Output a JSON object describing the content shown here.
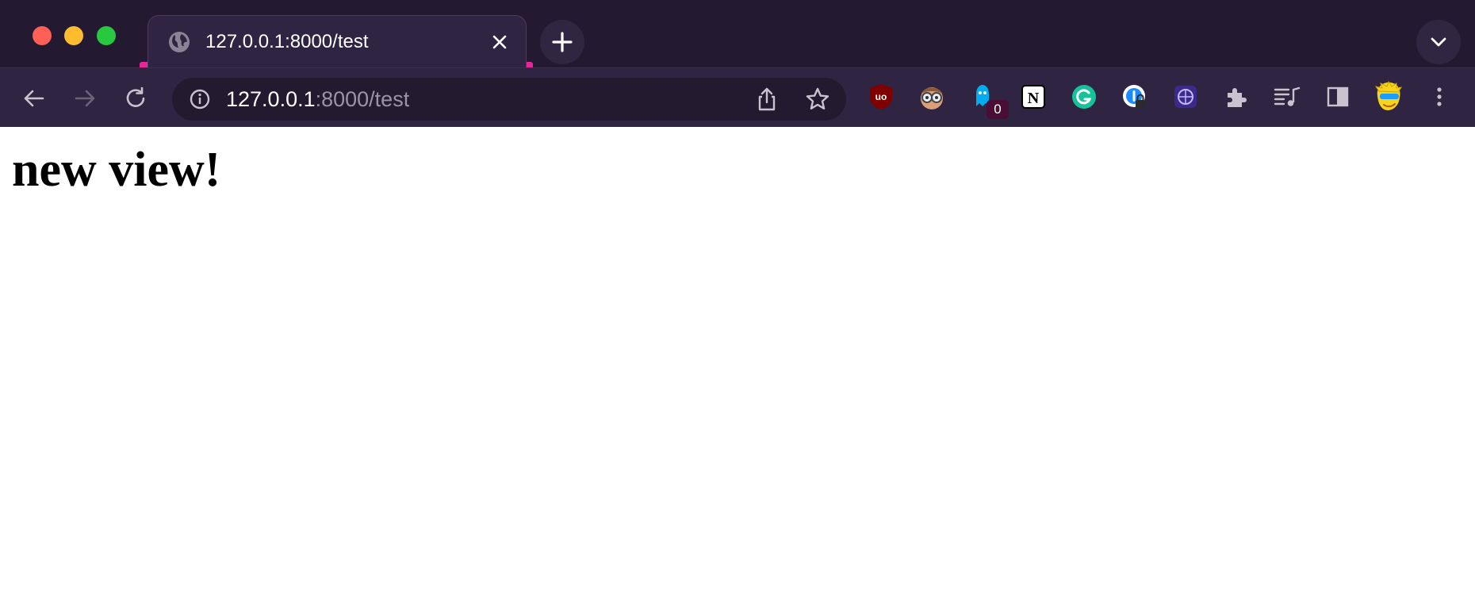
{
  "tab": {
    "title": "127.0.0.1:8000/test",
    "favicon": "globe-icon",
    "accent_color": "#e8259a"
  },
  "address_bar": {
    "host": "127.0.0.1",
    "rest": ":8000/test"
  },
  "extensions": [
    {
      "name": "ublock-origin-icon"
    },
    {
      "name": "glasses-face-icon"
    },
    {
      "name": "ghostery-icon",
      "badge": "0"
    },
    {
      "name": "notion-icon"
    },
    {
      "name": "grammarly-icon"
    },
    {
      "name": "password-manager-icon"
    },
    {
      "name": "purple-compass-icon"
    },
    {
      "name": "extensions-puzzle-icon"
    },
    {
      "name": "media-control-icon"
    },
    {
      "name": "side-panel-icon"
    },
    {
      "name": "profile-avatar-icon"
    },
    {
      "name": "menu-kebab-icon"
    }
  ],
  "page": {
    "heading": "new view!"
  },
  "colors": {
    "chrome_bg": "#231a31",
    "toolbar_bg": "#2f2441",
    "omnibox_bg": "#231a30"
  }
}
